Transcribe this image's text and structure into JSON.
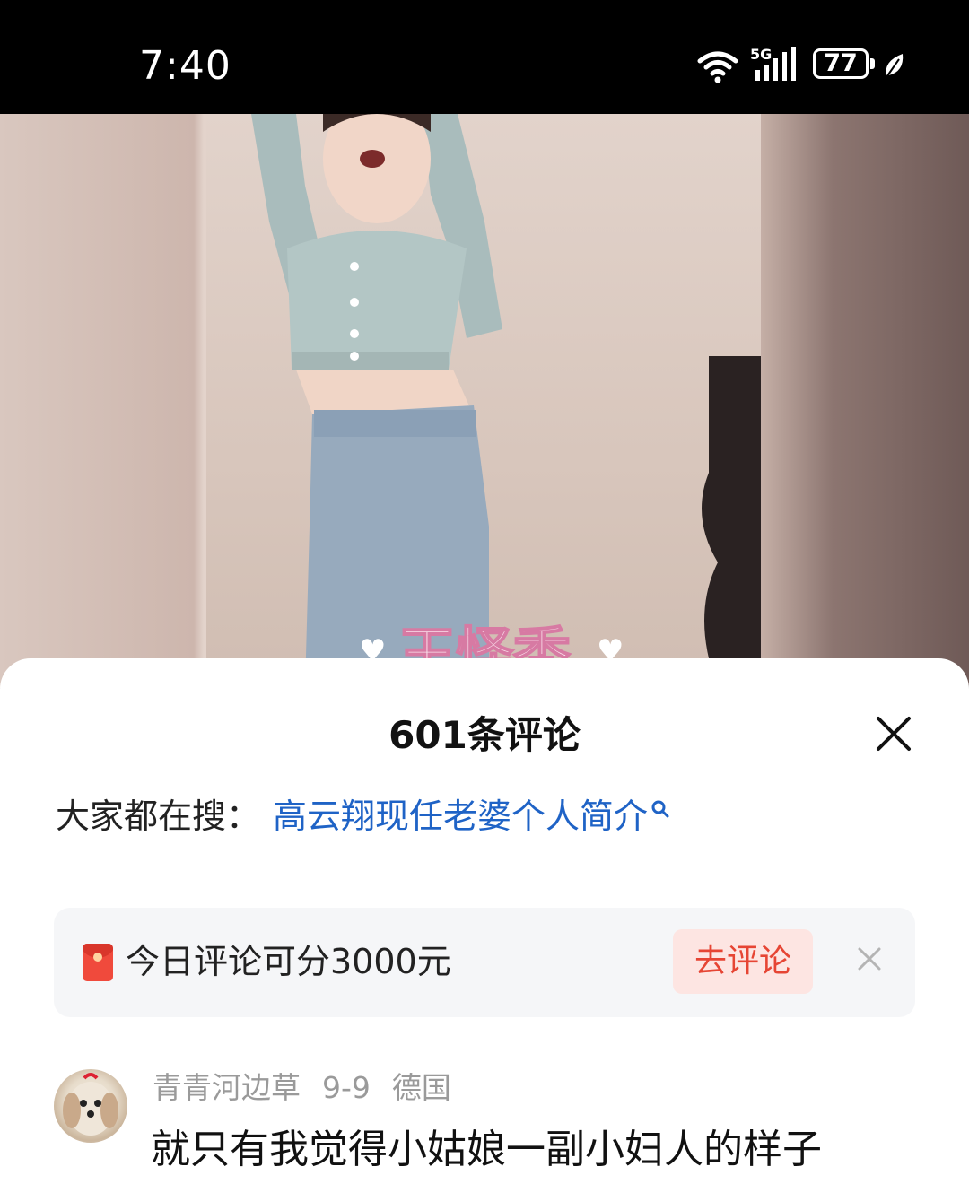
{
  "status_bar": {
    "time": "7:40",
    "network": "5G",
    "battery": "77",
    "icons": [
      "wifi-icon",
      "signal-icon",
      "battery-icon",
      "leaf-icon"
    ]
  },
  "video": {
    "overlay_text": "王怪秃"
  },
  "comments_panel": {
    "title": "601条评论",
    "hot_search": {
      "label": "大家都在搜：",
      "query": "高云翔现任老婆个人简介"
    },
    "promo": {
      "text": "今日评论可分3000元",
      "button_label": "去评论",
      "accent_color": "#e64534"
    },
    "comments": [
      {
        "author": "青青河边草",
        "date": "9-9",
        "location": "德国",
        "text": "就只有我觉得小姑娘一副小妇人的样子"
      }
    ]
  },
  "colors": {
    "link": "#1f63c6",
    "meta": "#9a9a9a"
  }
}
